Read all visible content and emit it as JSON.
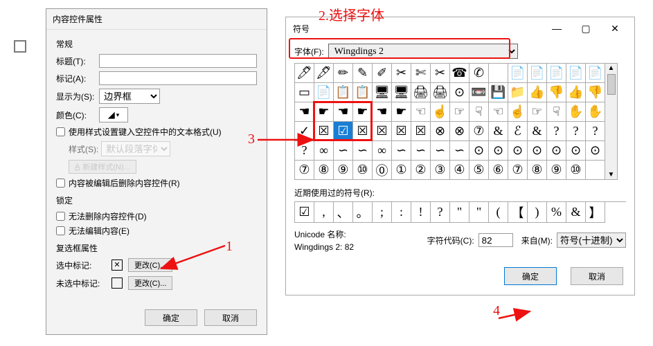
{
  "annotations": {
    "a1": "1",
    "a2": "2.选择字体",
    "a3": "3",
    "a4": "4"
  },
  "left_dialog": {
    "title": "内容控件属性",
    "sections": {
      "general": "常规",
      "lock": "锁定",
      "checkbox_props": "复选框属性"
    },
    "title_label": "标题(T):",
    "title_value": "",
    "tag_label": "标记(A):",
    "tag_value": "",
    "show_as_label": "显示为(S):",
    "show_as_value": "边界框",
    "color_label": "颜色(C):",
    "use_style_label": "使用样式设置键入空控件中的文本格式(U)",
    "style_label": "样式(S):",
    "style_value": "默认段落字体",
    "new_style_btn": "新建样式(N)...",
    "remove_on_edit_label": "内容被编辑后删除内容控件(R)",
    "lock_delete_label": "无法删除内容控件(D)",
    "lock_edit_label": "无法编辑内容(E)",
    "checked_sym_label": "选中标记:",
    "unchecked_sym_label": "未选中标记:",
    "change_btn": "更改(C)...",
    "ok": "确定",
    "cancel": "取消"
  },
  "right_dialog": {
    "title": "符号",
    "font_label": "字体(F):",
    "font_value": "Wingdings 2",
    "recent_label": "近期使用过的符号(R):",
    "unicode_name_label": "Unicode 名称:",
    "unicode_name_value": "Wingdings 2: 82",
    "char_code_label": "字符代码(C):",
    "char_code_value": "82",
    "from_label": "来自(M):",
    "from_value": "符号(十进制)",
    "ok": "确定",
    "cancel": "取消",
    "grid_rows": [
      [
        "🖊",
        "🖋",
        "✏",
        "✎",
        "✐",
        "✂",
        "✄",
        "✂",
        "☎",
        "✆",
        "",
        "📄",
        "📄",
        "📄",
        "📄",
        "📄"
      ],
      [
        "▭",
        "📄",
        "📋",
        "📋",
        "🖥",
        "🖥",
        "🖨",
        "🖨",
        "⊙",
        "📼",
        "💾",
        "📁",
        "👍",
        "👎",
        "👍",
        "👎"
      ],
      [
        "☚",
        "☛",
        "☚",
        "☛",
        "☚",
        "☛",
        "☜",
        "☝",
        "☞",
        "☟",
        "☜",
        "☝",
        "☞",
        "☟",
        "✋",
        "✋"
      ],
      [
        "✓",
        "☒",
        "☑",
        "☒",
        "☒",
        "☒",
        "☒",
        "⊗",
        "⊗",
        "⑦",
        "&",
        "ℰ",
        "&",
        "?",
        "?",
        "?"
      ],
      [
        "?",
        "∞",
        "∽",
        "∽",
        "∞",
        "∽",
        "∽",
        "∽",
        "∽",
        "⊙",
        "⊙",
        "⊙",
        "⊙",
        "⊙",
        "⊙",
        "⊙"
      ],
      [
        "⑦",
        "⑧",
        "⑨",
        "⑩",
        "⓪",
        "①",
        "②",
        "③",
        "④",
        "⑤",
        "⑥",
        "⑦",
        "⑧",
        "⑨",
        "⑩",
        ""
      ]
    ],
    "selected_cell": {
      "row": 3,
      "col": 2
    },
    "recent_symbols": [
      "☑",
      ",",
      "、",
      "。",
      ";",
      ":",
      "!",
      "?",
      "\"",
      "\"",
      "(",
      "【",
      ")",
      "%",
      "&",
      "】"
    ]
  }
}
